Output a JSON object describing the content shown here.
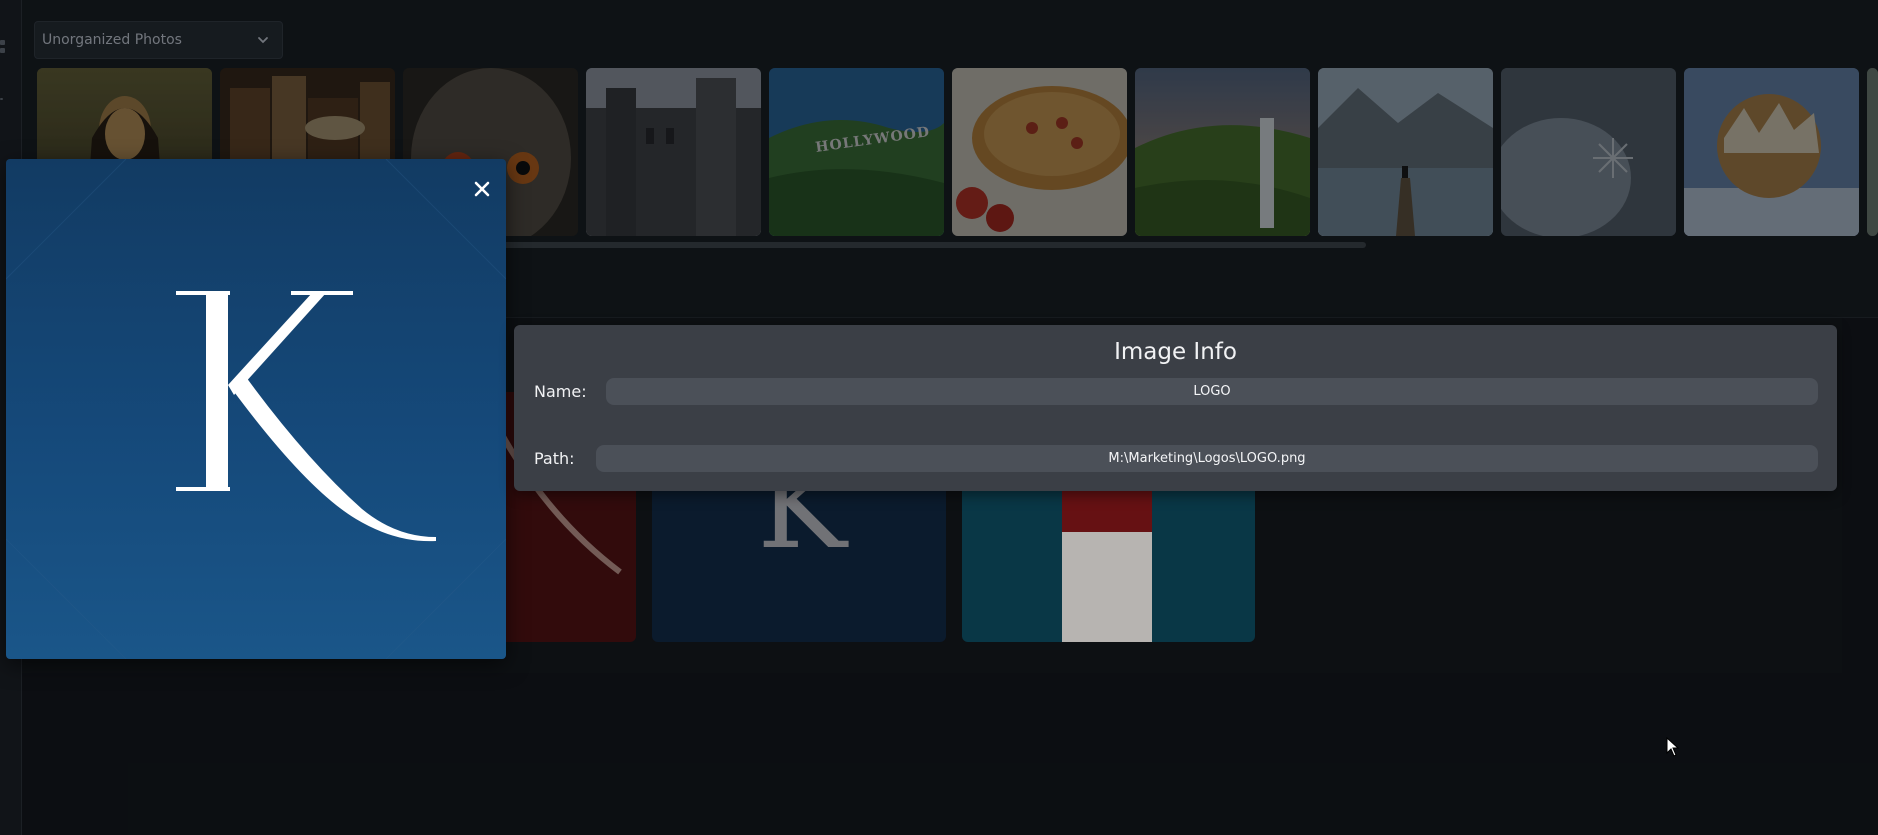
{
  "album_selector": {
    "selected": "Unorganized Photos",
    "icon": "chevron-down-icon"
  },
  "thumbnails": [
    {
      "name": "mona-lisa"
    },
    {
      "name": "old-books"
    },
    {
      "name": "owl"
    },
    {
      "name": "gothic-castle"
    },
    {
      "name": "hollywood-sign"
    },
    {
      "name": "pizza"
    },
    {
      "name": "waterfall"
    },
    {
      "name": "fjord-dock"
    },
    {
      "name": "snowflake"
    },
    {
      "name": "frozen-bubble"
    }
  ],
  "hollywood_sign_text": "HOLLYWOOD",
  "preview": {
    "letter": "K",
    "close_icon": "close-icon"
  },
  "image_info": {
    "title": "Image Info",
    "name_label": "Name:",
    "name_value": "LOGO",
    "path_label": "Path:",
    "path_value": "M:\\Marketing\\Logos\\LOGO.png"
  },
  "grid_cards": [
    {
      "name": "red-logo-card"
    },
    {
      "name": "navy-logo-card"
    },
    {
      "name": "lighthouse-card"
    }
  ],
  "colors": {
    "background": "#0f1216",
    "panel": "#3b3f46",
    "field": "#4b5058",
    "preview_blue": "#15497a"
  }
}
